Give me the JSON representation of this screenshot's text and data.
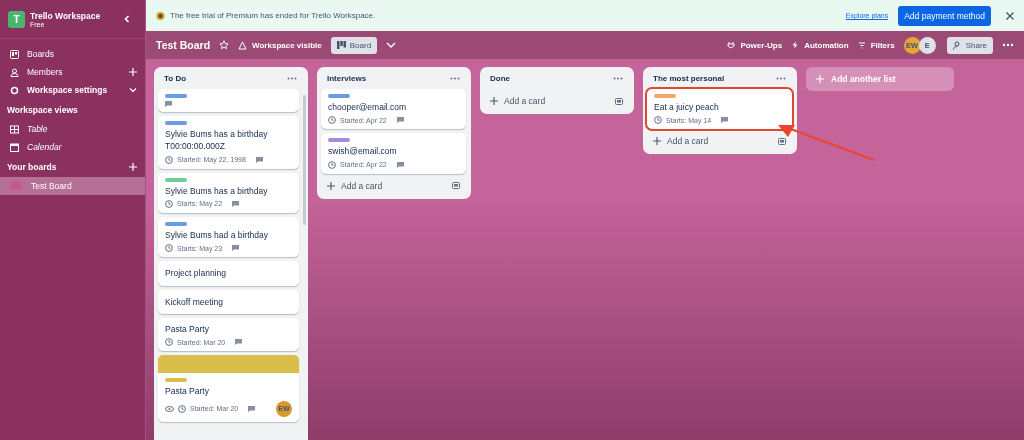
{
  "workspace": {
    "initial": "T",
    "name": "Trello Workspace",
    "plan": "Free"
  },
  "sidebar": {
    "items": [
      "Boards",
      "Members",
      "Workspace settings"
    ],
    "views_heading": "Workspace views",
    "views": [
      "Table",
      "Calendar"
    ],
    "boards_heading": "Your boards",
    "boards": [
      {
        "label": "Test Board",
        "selected": true,
        "color": "#c25a8f"
      }
    ]
  },
  "banner": {
    "text": "The free trial of Premium has ended for Trello Workspace.",
    "link": "Explore plans",
    "button": "Add payment method"
  },
  "board": {
    "title": "Test Board",
    "visibility": "Workspace visible",
    "view": "Board",
    "actions": [
      "Power-Ups",
      "Automation",
      "Filters"
    ],
    "members": [
      {
        "initials": "EW",
        "color": "#e8a33a"
      },
      {
        "initials": "E",
        "color": "#dfe1e6"
      }
    ],
    "share": "Share"
  },
  "lists": [
    {
      "title": "To Do",
      "cards": [
        {
          "color": "#6c9be6",
          "comment": true,
          "cover": false,
          "watch": false,
          "highlighted": false
        },
        {
          "color": "#6c9be6",
          "title": "Sylvie Bums has a birthday T00:00:00.000Z",
          "date": "Started: May 22, 1998",
          "comment": true,
          "cover": false,
          "watch": false,
          "highlighted": false
        },
        {
          "color": "#6fcf97",
          "title": "Sylvie Bums has a birthday",
          "date": "Starts: May 22",
          "comment": true,
          "cover": false,
          "watch": false,
          "highlighted": false
        },
        {
          "color": "#6c9be6",
          "title": "Sylvie Bums had a birthday",
          "date": "Starts: May 23",
          "comment": true,
          "cover": false,
          "watch": false,
          "highlighted": false
        },
        {
          "title": "Project planning",
          "comment": false,
          "cover": false,
          "watch": false,
          "highlighted": false
        },
        {
          "title": "Kickoff meeting",
          "comment": false,
          "cover": false,
          "watch": false,
          "highlighted": false
        },
        {
          "title": "Pasta Party",
          "date": "Started: Mar 20",
          "comment": true,
          "cover": false,
          "watch": false,
          "highlighted": false
        },
        {
          "color": "#d9be4a",
          "title": "Pasta Party",
          "date": "Started: Mar 20",
          "comment": true,
          "cover": true,
          "watch": true,
          "member": "EW",
          "highlighted": false
        }
      ]
    },
    {
      "title": "Interviews",
      "add_card": "Add a card",
      "cards": [
        {
          "color": "#6c9be6",
          "title": "chooper@email.com",
          "date": "Started: Apr 22",
          "comment": true,
          "cover": false,
          "watch": false,
          "highlighted": false
        },
        {
          "color": "#a48be0",
          "title": "swish@email.com",
          "date": "Started: Apr 22",
          "comment": true,
          "cover": false,
          "watch": false,
          "highlighted": false
        }
      ]
    },
    {
      "title": "Done",
      "add_card": "Add a card"
    },
    {
      "title": "The most personal",
      "add_card": "Add a card",
      "cards": [
        {
          "color": "#f0a868",
          "title": "Eat a juicy peach",
          "date": "Starts: May 14",
          "comment": true,
          "cover": false,
          "watch": false,
          "highlighted": true
        }
      ]
    }
  ],
  "add_list": "Add another list"
}
